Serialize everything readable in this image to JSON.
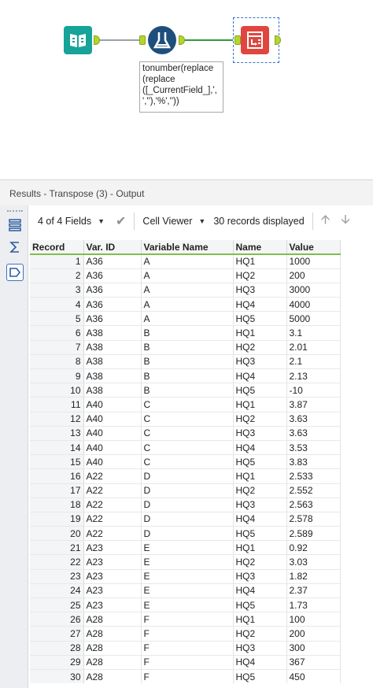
{
  "canvas": {
    "annotation_text": "tonumber(replace\n(replace\n([_CurrentField_],',\n',''),'%',''))",
    "tools": [
      {
        "name": "input-data-tool",
        "color": "#15a39a"
      },
      {
        "name": "formula-tool",
        "color": "#1e4f7c"
      },
      {
        "name": "transpose-tool",
        "color": "#e0463f"
      }
    ]
  },
  "results": {
    "title": "Results - Transpose (3) - Output",
    "toolbar": {
      "fields_label": "4 of 4 Fields",
      "viewer_label": "Cell Viewer",
      "records_label": "30 records displayed"
    },
    "columns": [
      "Record",
      "Var. ID",
      "Variable Name",
      "Name",
      "Value"
    ],
    "rows": [
      [
        "1",
        "A36",
        "A",
        "HQ1",
        "1000"
      ],
      [
        "2",
        "A36",
        "A",
        "HQ2",
        "200"
      ],
      [
        "3",
        "A36",
        "A",
        "HQ3",
        "3000"
      ],
      [
        "4",
        "A36",
        "A",
        "HQ4",
        "4000"
      ],
      [
        "5",
        "A36",
        "A",
        "HQ5",
        "5000"
      ],
      [
        "6",
        "A38",
        "B",
        "HQ1",
        "3.1"
      ],
      [
        "7",
        "A38",
        "B",
        "HQ2",
        "2.01"
      ],
      [
        "8",
        "A38",
        "B",
        "HQ3",
        "2.1"
      ],
      [
        "9",
        "A38",
        "B",
        "HQ4",
        "2.13"
      ],
      [
        "10",
        "A38",
        "B",
        "HQ5",
        "-10"
      ],
      [
        "11",
        "A40",
        "C",
        "HQ1",
        "3.87"
      ],
      [
        "12",
        "A40",
        "C",
        "HQ2",
        "3.63"
      ],
      [
        "13",
        "A40",
        "C",
        "HQ3",
        "3.63"
      ],
      [
        "14",
        "A40",
        "C",
        "HQ4",
        "3.53"
      ],
      [
        "15",
        "A40",
        "C",
        "HQ5",
        "3.83"
      ],
      [
        "16",
        "A22",
        "D",
        "HQ1",
        "2.533"
      ],
      [
        "17",
        "A22",
        "D",
        "HQ2",
        "2.552"
      ],
      [
        "18",
        "A22",
        "D",
        "HQ3",
        "2.563"
      ],
      [
        "19",
        "A22",
        "D",
        "HQ4",
        "2.578"
      ],
      [
        "20",
        "A22",
        "D",
        "HQ5",
        "2.589"
      ],
      [
        "21",
        "A23",
        "E",
        "HQ1",
        "0.92"
      ],
      [
        "22",
        "A23",
        "E",
        "HQ2",
        "3.03"
      ],
      [
        "23",
        "A23",
        "E",
        "HQ3",
        "1.82"
      ],
      [
        "24",
        "A23",
        "E",
        "HQ4",
        "2.37"
      ],
      [
        "25",
        "A23",
        "E",
        "HQ5",
        "1.73"
      ],
      [
        "26",
        "A28",
        "F",
        "HQ1",
        "100"
      ],
      [
        "27",
        "A28",
        "F",
        "HQ2",
        "200"
      ],
      [
        "28",
        "A28",
        "F",
        "HQ3",
        "300"
      ],
      [
        "29",
        "A28",
        "F",
        "HQ4",
        "367"
      ],
      [
        "30",
        "A28",
        "F",
        "HQ5",
        "450"
      ]
    ]
  }
}
